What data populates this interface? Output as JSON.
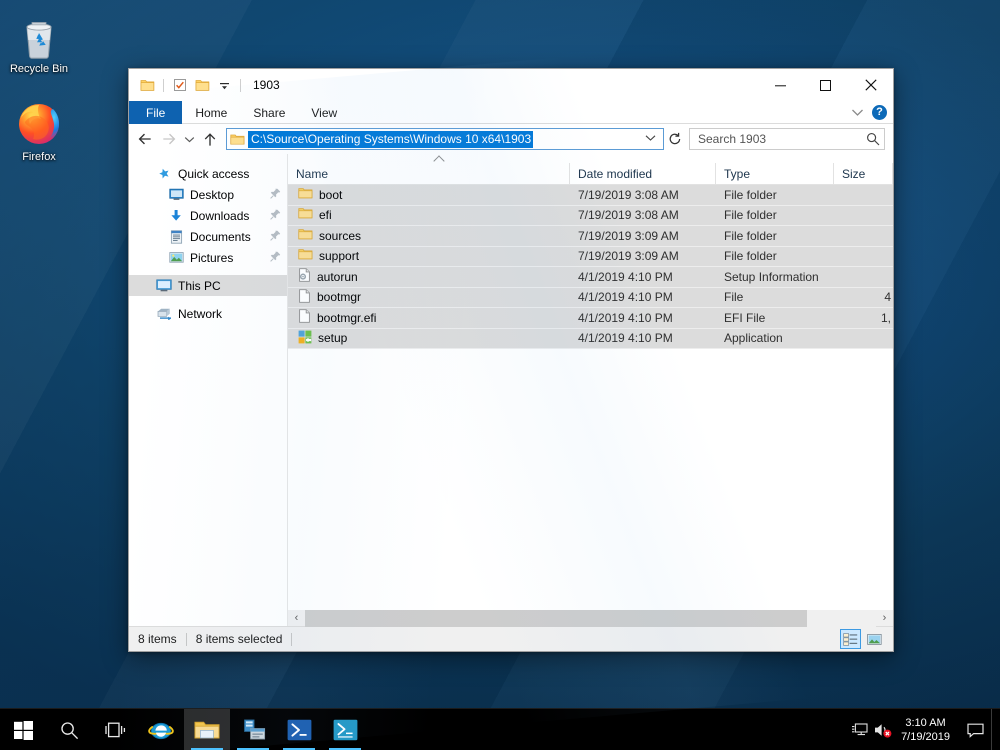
{
  "desktop": {
    "icons": [
      {
        "name": "recycle-bin",
        "label": "Recycle Bin"
      },
      {
        "name": "firefox",
        "label": "Firefox"
      }
    ]
  },
  "window": {
    "title": "1903",
    "quick_access_toolbar": [
      "properties-folder",
      "new-folder-checked",
      "folder",
      "customize-dropdown"
    ],
    "controls": {
      "minimize": "—",
      "maximize": "☐",
      "close": "✕"
    },
    "ribbon": {
      "tabs": [
        {
          "label": "File",
          "active": true
        },
        {
          "label": "Home",
          "active": false
        },
        {
          "label": "Share",
          "active": false
        },
        {
          "label": "View",
          "active": false
        }
      ],
      "collapse_label": "⌄",
      "help_label": "?"
    },
    "address": {
      "path": "C:\\Source\\Operating Systems\\Windows 10 x64\\1903",
      "dropdown_caret": "⌄",
      "refresh_label": "↻"
    },
    "search": {
      "placeholder": "Search 1903"
    },
    "nav_pane": {
      "items": [
        {
          "label": "Quick access",
          "icon": "star-icon",
          "level": 0,
          "pinned": false,
          "selected": false
        },
        {
          "label": "Desktop",
          "icon": "desktop-icon",
          "level": 1,
          "pinned": true,
          "selected": false
        },
        {
          "label": "Downloads",
          "icon": "downloads-icon",
          "level": 1,
          "pinned": true,
          "selected": false
        },
        {
          "label": "Documents",
          "icon": "documents-icon",
          "level": 1,
          "pinned": true,
          "selected": false
        },
        {
          "label": "Pictures",
          "icon": "pictures-icon",
          "level": 1,
          "pinned": true,
          "selected": false
        },
        {
          "label": "This PC",
          "icon": "this-pc-icon",
          "level": 0,
          "pinned": false,
          "selected": true
        },
        {
          "label": "Network",
          "icon": "network-icon",
          "level": 0,
          "pinned": false,
          "selected": false
        }
      ]
    },
    "file_list": {
      "columns": [
        "Name",
        "Date modified",
        "Type",
        "Size"
      ],
      "sort_column": "Name",
      "sort_direction": "ascending",
      "rows": [
        {
          "name": "boot",
          "date": "7/19/2019 3:08 AM",
          "type": "File folder",
          "size": "",
          "icon": "folder-icon",
          "selected": true
        },
        {
          "name": "efi",
          "date": "7/19/2019 3:08 AM",
          "type": "File folder",
          "size": "",
          "icon": "folder-icon",
          "selected": true
        },
        {
          "name": "sources",
          "date": "7/19/2019 3:09 AM",
          "type": "File folder",
          "size": "",
          "icon": "folder-icon",
          "selected": true
        },
        {
          "name": "support",
          "date": "7/19/2019 3:09 AM",
          "type": "File folder",
          "size": "",
          "icon": "folder-icon",
          "selected": true
        },
        {
          "name": "autorun",
          "date": "4/1/2019 4:10 PM",
          "type": "Setup Information",
          "size": "",
          "icon": "setup-info-icon",
          "selected": true
        },
        {
          "name": "bootmgr",
          "date": "4/1/2019 4:10 PM",
          "type": "File",
          "size": "4",
          "icon": "file-icon",
          "selected": true
        },
        {
          "name": "bootmgr.efi",
          "date": "4/1/2019 4:10 PM",
          "type": "EFI File",
          "size": "1,",
          "icon": "file-icon",
          "selected": true
        },
        {
          "name": "setup",
          "date": "4/1/2019 4:10 PM",
          "type": "Application",
          "size": "",
          "icon": "application-icon",
          "selected": true
        }
      ]
    },
    "hscroll": {
      "left_arrow": "‹",
      "right_arrow": "›"
    },
    "status": {
      "item_count": "8 items",
      "selected_count": "8 items selected",
      "views": [
        {
          "name": "details-view",
          "active": true
        },
        {
          "name": "large-icons-view",
          "active": false
        }
      ]
    }
  },
  "taskbar": {
    "buttons": [
      {
        "name": "start-button",
        "icon": "windows-logo-icon",
        "active": false,
        "running": false
      },
      {
        "name": "search-button",
        "icon": "search-icon",
        "active": false,
        "running": false
      },
      {
        "name": "task-view-button",
        "icon": "task-view-icon",
        "active": false,
        "running": false
      },
      {
        "name": "internet-explorer",
        "icon": "internet-explorer-icon",
        "active": false,
        "running": false
      },
      {
        "name": "file-explorer",
        "icon": "file-explorer-icon",
        "active": true,
        "running": true
      },
      {
        "name": "server-manager",
        "icon": "server-manager-icon",
        "active": false,
        "running": true
      },
      {
        "name": "windows-powershell",
        "icon": "powershell-icon",
        "active": false,
        "running": true
      },
      {
        "name": "powershell-ise",
        "icon": "powershell-ise-icon",
        "active": false,
        "running": true
      }
    ],
    "tray": {
      "icons": [
        "network-icon",
        "volume-muted-icon"
      ],
      "clock_time": "3:10 AM",
      "clock_date": "7/19/2019",
      "action_center": "notification-icon"
    }
  },
  "colors": {
    "accent": "#0078d7",
    "file_tab": "#0e62b0",
    "selection": "#dcdcdc",
    "taskbar_indicator": "#4cc2ff",
    "help_blue": "#0d6ab8"
  }
}
